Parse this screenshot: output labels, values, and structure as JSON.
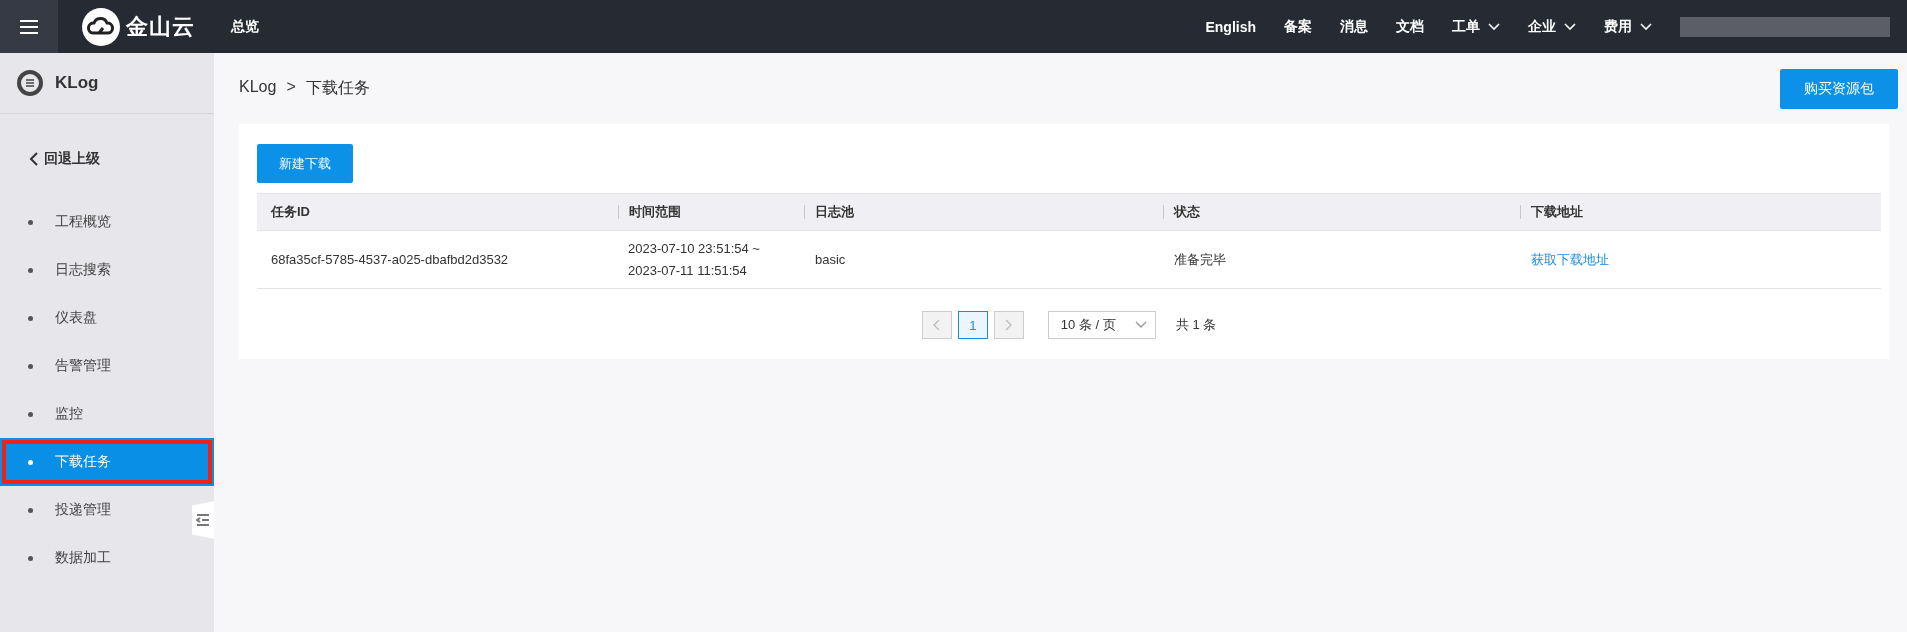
{
  "top_bar": {
    "logo": "金山云",
    "overview": "总览",
    "links": [
      {
        "label": "English",
        "dropdown": false
      },
      {
        "label": "备案",
        "dropdown": false
      },
      {
        "label": "消息",
        "dropdown": false
      },
      {
        "label": "文档",
        "dropdown": false
      },
      {
        "label": "工单",
        "dropdown": true
      },
      {
        "label": "企业",
        "dropdown": true
      },
      {
        "label": "费用",
        "dropdown": true
      }
    ]
  },
  "sidebar": {
    "title": "KLog",
    "back": "回退上级",
    "items": [
      {
        "label": "工程概览",
        "selected": false
      },
      {
        "label": "日志搜索",
        "selected": false
      },
      {
        "label": "仪表盘",
        "selected": false
      },
      {
        "label": "告警管理",
        "selected": false
      },
      {
        "label": "监控",
        "selected": false
      },
      {
        "label": "下载任务",
        "selected": true
      },
      {
        "label": "投递管理",
        "selected": false
      },
      {
        "label": "数据加工",
        "selected": false
      }
    ]
  },
  "breadcrumb": {
    "root": "KLog",
    "separator": ">",
    "current": "下载任务"
  },
  "buy_button": "购买资源包",
  "new_button": "新建下载",
  "table": {
    "columns": [
      "任务ID",
      "时间范围",
      "日志池",
      "状态",
      "下载地址"
    ],
    "rows": [
      {
        "id": "68fa35cf-5785-4537-a025-dbafbd2d3532",
        "time_start": "2023-07-10 23:51:54 ~",
        "time_end": "2023-07-11 11:51:54",
        "pool": "basic",
        "status": "准备完毕",
        "link": "获取下载地址"
      }
    ]
  },
  "pagination": {
    "prev_disabled": true,
    "next_disabled": true,
    "pages": [
      {
        "label": "1",
        "selected": true
      }
    ],
    "page_size": "10 条 / 页",
    "total": "共 1 条"
  }
}
